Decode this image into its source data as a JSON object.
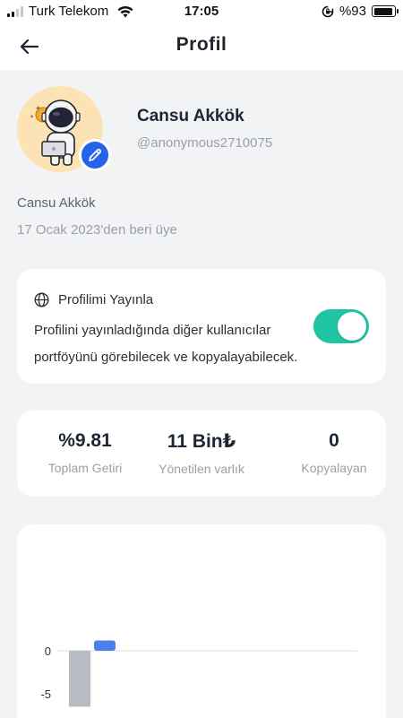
{
  "status_bar": {
    "carrier": "Turk Telekom",
    "time": "17:05",
    "battery": "%93",
    "battery_level": 0.93
  },
  "header": {
    "title": "Profil"
  },
  "profile": {
    "display_name": "Cansu Akkök",
    "username": "@anonymous2710075",
    "full_name": "Cansu Akkök",
    "member_since": "17 Ocak 2023'den beri üye"
  },
  "publish": {
    "title": "Profilimi Yayınla",
    "description": "Profilini yayınladığında diğer kullanıcılar portföyünü görebilecek ve kopyalayabilecek.",
    "enabled": true
  },
  "stats": [
    {
      "value": "%9.81",
      "label": "Toplam Getiri"
    },
    {
      "value": "11 Bin₺",
      "label": "Yönetilen varlık"
    },
    {
      "value": "0",
      "label": "Kopyalayan"
    }
  ],
  "colors": {
    "accent": "#2563eb",
    "toggle_on": "#20c4a2",
    "bar_blue": "#4f7fe8",
    "bar_gray": "#b8bcc2"
  },
  "chart_data": {
    "type": "bar",
    "tick_labels": [
      "0",
      "-5"
    ],
    "series": [
      {
        "values": [
          -6.5
        ],
        "color": "#b8bcc2"
      },
      {
        "values": [
          1.2
        ],
        "color": "#4f7fe8"
      }
    ]
  }
}
